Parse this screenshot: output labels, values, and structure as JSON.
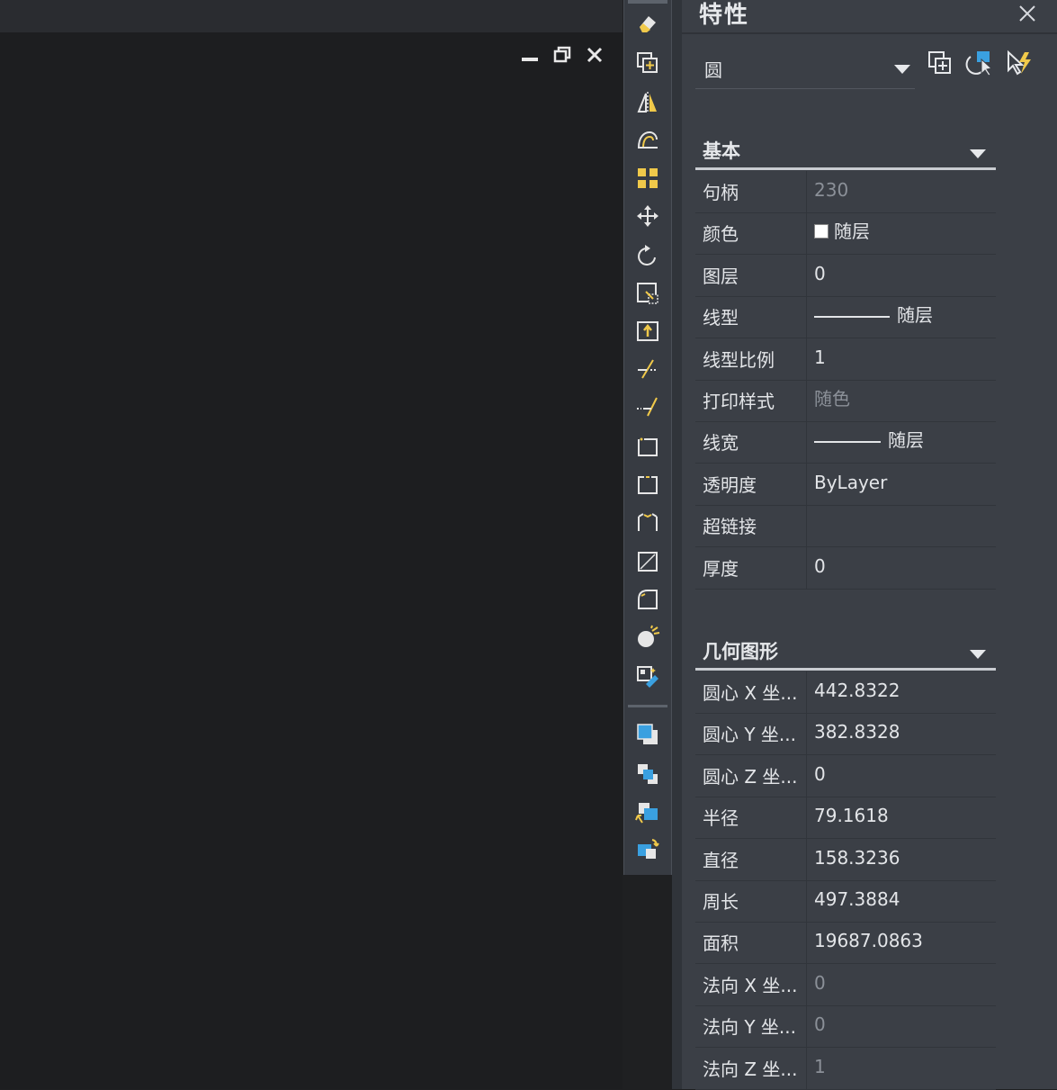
{
  "drawing": {
    "window_controls": [
      "minimize-icon",
      "restore-icon",
      "close-icon"
    ]
  },
  "toolbar": {
    "tools": [
      "erase-icon",
      "copy-icon",
      "mirror-icon",
      "offset-icon",
      "array-icon",
      "move-icon",
      "rotate-icon",
      "scale-icon",
      "stretch-icon",
      "trim-icon",
      "extend-icon",
      "break-at-point-icon",
      "break-icon",
      "join-icon",
      "chamfer-icon",
      "fillet-icon",
      "explode-icon",
      "edit-properties-icon",
      "bring-to-front-icon",
      "send-to-back-icon",
      "bring-above-icon",
      "send-under-icon"
    ]
  },
  "panel": {
    "title": "特性",
    "object_type": "圆",
    "sections": {
      "basic": {
        "title": "基本",
        "rows": [
          {
            "name": "句柄",
            "value": "230",
            "dim": true
          },
          {
            "name": "颜色",
            "value": "随层",
            "swatch": "#ffffff"
          },
          {
            "name": "图层",
            "value": "0"
          },
          {
            "name": "线型",
            "value": "随层",
            "line": 84
          },
          {
            "name": "线型比例",
            "value": "1"
          },
          {
            "name": "打印样式",
            "value": "随色",
            "dim": true
          },
          {
            "name": "线宽",
            "value": "随层",
            "line": 74
          },
          {
            "name": "透明度",
            "value": "ByLayer"
          },
          {
            "name": "超链接",
            "value": ""
          },
          {
            "name": "厚度",
            "value": "0"
          }
        ]
      },
      "geometry": {
        "title": "几何图形",
        "rows": [
          {
            "name": "圆心 X 坐...",
            "value": "442.8322"
          },
          {
            "name": "圆心 Y 坐...",
            "value": "382.8328"
          },
          {
            "name": "圆心 Z 坐...",
            "value": "0"
          },
          {
            "name": "半径",
            "value": "79.1618"
          },
          {
            "name": "直径",
            "value": "158.3236"
          },
          {
            "name": "周长",
            "value": "497.3884"
          },
          {
            "name": "面积",
            "value": "19687.0863"
          },
          {
            "name": "法向 X 坐...",
            "value": "0",
            "dim": true
          },
          {
            "name": "法向 Y 坐...",
            "value": "0",
            "dim": true
          },
          {
            "name": "法向 Z 坐...",
            "value": "1",
            "dim": true
          }
        ]
      }
    }
  }
}
